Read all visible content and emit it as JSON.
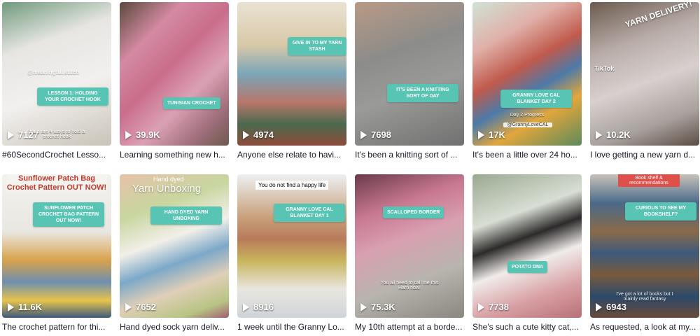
{
  "videos": [
    {
      "views": "7127",
      "caption": "#60SecondCrochet Lesso...",
      "badge": "LESSON 1: HOLDING YOUR CROCHET HOOK",
      "sub": "there are 4 ways to hold a crochet hook",
      "watermark": "@meaningful.stitch",
      "bg": "linear-gradient(160deg,#6f9a7c 0%,#e8e6e3 30%,#f2f0ee 60%,#c9c3b8 100%)"
    },
    {
      "views": "39.9K",
      "caption": "Learning something new h...",
      "badge": "TUNISIAN CROCHET",
      "bg": "linear-gradient(135deg,#5a4a3c 0%,#d48aa2 25%,#c96d8b 45%,#dba0b4 65%,#9c6c78 85%,#6d5a4e 100%)"
    },
    {
      "views": "4974",
      "caption": "Anyone else relate to havi...",
      "badge": "GIVE IN TO MY YARN STASH",
      "bg": "linear-gradient(180deg,#e9e2d2 0%,#d9c8a8 30%,#7aa6b8 50%,#b8766a 70%,#4a6a4e 85%,#8e4b3a 100%)"
    },
    {
      "views": "7698",
      "caption": "It's been a knitting sort of ...",
      "badge": "IT'S BEEN A KNITTING SORT OF DAY",
      "bg": "linear-gradient(160deg,#b89a86 0%,#8c8c8a 35%,#9a9a98 60%,#707070 100%)"
    },
    {
      "views": "17K",
      "caption": "It's been a little over 24 ho...",
      "badge": "GRANNY LOVE CAL BLANKET DAY 2",
      "sub": "Day 2 Progress",
      "sub2": "@GrannyLoveCAL",
      "bg": "linear-gradient(150deg,#cfe3d6 0%,#e0b0a8 25%,#c05a4c 45%,#4c7aa8 60%,#e2a63c 75%,#5b8a5c 100%)"
    },
    {
      "views": "10.2K",
      "caption": "I love getting a new yarn d...",
      "banner": "YARN DELIVERY!",
      "watermark": "TikTok",
      "bg": "linear-gradient(160deg,#6b5a4e 0%,#b8aca8 30%,#d8d0ce 55%,#a8a09c 80%,#5a4c44 100%)"
    },
    {
      "views": "11.6K",
      "caption": "The crochet pattern for thi...",
      "badge": "SUNFLOWER PATCH CROCHET BAG PATTERN OUT NOW!",
      "banner": "Sunflower Patch Bag Crochet Pattern OUT NOW!",
      "bg": "linear-gradient(180deg,#f3f1ec 0%,#e9e7e2 40%,#d8a24a 60%,#6f8fb0 75%,#e8c44c 88%,#3c5a7c 100%)"
    },
    {
      "views": "7652",
      "caption": "Hand dyed sock yarn deliv...",
      "badge": "HAND DYED YARN UNBOXING",
      "banner": "Yarn Unboxing",
      "banner_top": "Hand dyed",
      "bg": "linear-gradient(160deg,#e6c2a8 0%,#c8d6a0 25%,#f2efe8 45%,#7ca8c8 60%,#e0cfb8 75%,#b8c484 90%,#a06070 100%)"
    },
    {
      "views": "8916",
      "caption": "1 week until the Granny Lo...",
      "badge": "GRANNY LOVE CAL BLANKET DAY 1",
      "banner": "You do not find a happy life",
      "bg": "linear-gradient(180deg,#eef0f3 0%,#c8a07a 30%,#b87a5a 45%,#c8b45c 60%,#e8e6e0 80%,#d0d4d8 100%)"
    },
    {
      "views": "75.3K",
      "caption": "My 10th attempt at a borde...",
      "badge": "SCALLOPED BORDER",
      "sub": "You all need to call me this Harn now!",
      "bg": "linear-gradient(160deg,#6a3a4a 0%,#c87890 25%,#d8a0b0 45%,#b8b4ae 70%,#8a8680 100%)"
    },
    {
      "views": "7738",
      "caption": "She's such a cute kitty cat,...",
      "badge": "POTATO DNA",
      "bg": "linear-gradient(160deg,#9aa890 0%,#d8ded4 30%,#2c2a2a 45%,#f0ecea 60%,#d8a0a4 80%,#b87078 100%)"
    },
    {
      "views": "6943",
      "caption": "As requested, a look at my...",
      "badge": "CURIOUS TO SEE MY BOOKSHELF?",
      "banner": "Book shelf & recommendations",
      "sub": "I've got a lot of books but I mainly read fantasy",
      "bg": "linear-gradient(180deg,#c8c2ba 0%,#4a6a88 20%,#8a6a4a 40%,#3c5a7a 55%,#7a5a3c 70%,#2c4a6a 85%,#6a4a3a 100%)"
    }
  ]
}
